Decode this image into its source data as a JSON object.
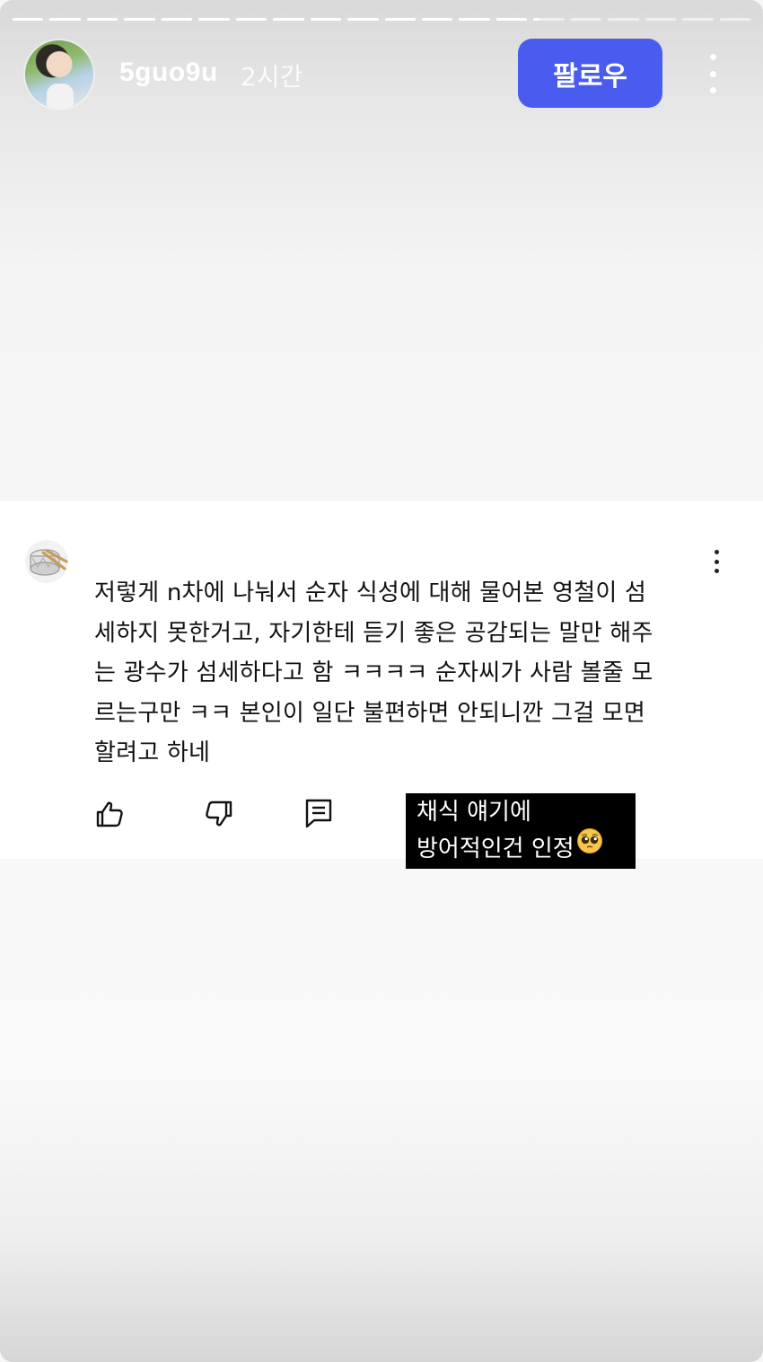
{
  "story": {
    "progress_total_segments": 20,
    "progress_completed_segments": 14,
    "progress_current_fraction": 0.2
  },
  "header": {
    "username": "5guo9u",
    "time_ago": "2시간",
    "follow_label": "팔로우",
    "avatar_icon": "avatar-photo",
    "more_icon": "vertical-ellipsis-icon",
    "follow_color": "#4a5cf0"
  },
  "comment": {
    "avatar_icon": "drum-icon",
    "text": "저렇게 n차에 나눠서 순자 식성에 대해 물어본 영철이 섬\n세하지 못한거고, 자기한테 듣기 좋은 공감되는 말만 해주\n는 광수가 섬세하다고 함 ㅋㅋㅋㅋ  순자씨가 사람 볼줄 모\n르는구만 ㅋㅋ 본인이 일단 불편하면 안되니깐 그걸 모면\n할려고 하네",
    "actions": {
      "like_icon": "thumbs-up-icon",
      "dislike_icon": "thumbs-down-icon",
      "reply_icon": "reply-comment-icon"
    },
    "more_icon": "vertical-ellipsis-icon"
  },
  "sticker": {
    "line1": "채식 얘기에",
    "line2": "방어적인건 인정",
    "emoji": "pleading-face-emoji"
  }
}
